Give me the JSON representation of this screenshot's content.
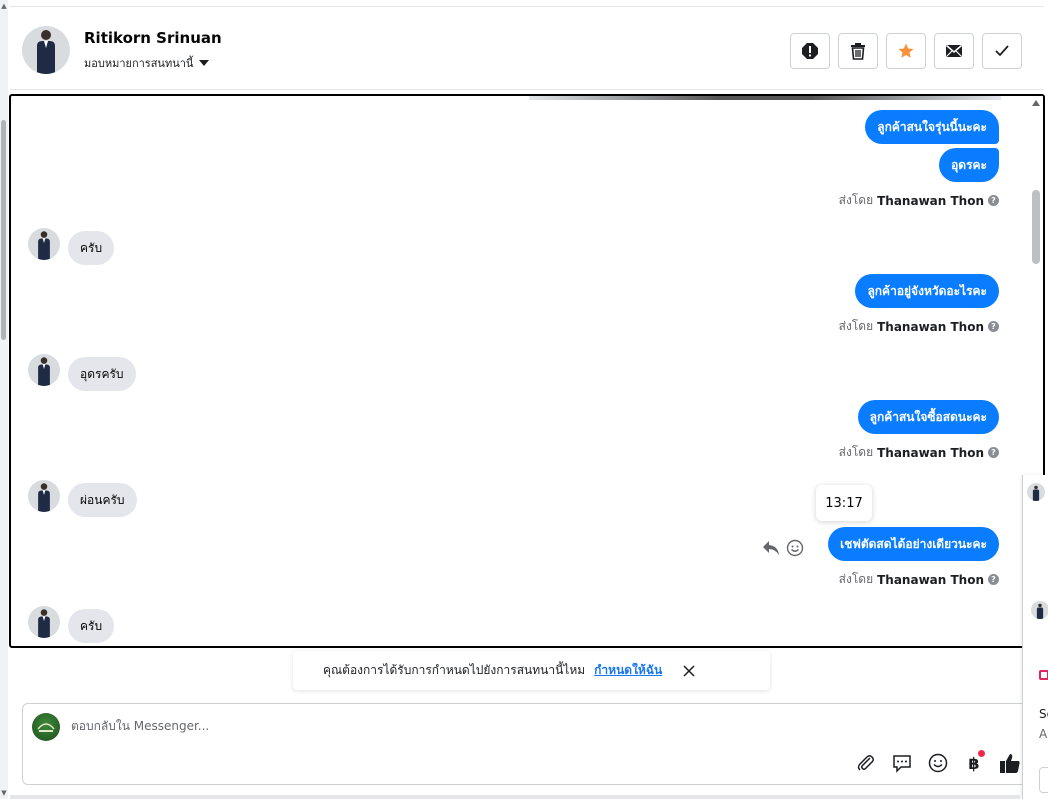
{
  "header": {
    "contact_name": "Ritikorn Srinuan",
    "assign_label": "มอบหมายการสนทนานี้",
    "actions": [
      {
        "name": "report-button",
        "icon": "alert-icon"
      },
      {
        "name": "delete-button",
        "icon": "trash-icon"
      },
      {
        "name": "star-button",
        "icon": "star-icon",
        "color": "#f7923a"
      },
      {
        "name": "mark-unread-button",
        "icon": "envelope-icon"
      },
      {
        "name": "mark-done-button",
        "icon": "check-icon"
      }
    ]
  },
  "messages": {
    "out1": "ลูกค้าสนใจรุ่นนี้นะคะ",
    "out2": "อุดรคะ",
    "in1": "ครับ",
    "out3": "ลูกค้าอยู่จังหวัดอะไรคะ",
    "in2": "อุดรครับ",
    "out4": "ลูกค้าสนใจซื้อสดนะคะ",
    "in3": "ผ่อนครับ",
    "out5": "เชฟตัดสดได้อย่างเดียวนะคะ",
    "in4": "ครับ",
    "sent_by_prefix": "ส่งโดย",
    "sent_by_name": "Thanawan Thon",
    "tooltip_time": "13:17",
    "help_mark": "?"
  },
  "banner": {
    "text": "คุณต้องการได้รับการกำหนดไปยังการสนทนานี้ไหม",
    "link": "กำหนดให้ฉัน"
  },
  "composer": {
    "placeholder": "ตอบกลับใน Messenger...",
    "currency_symbol": "฿"
  },
  "right_panel": {
    "text1": "Se",
    "text2": "A"
  },
  "colors": {
    "outgoing_bubble": "#0a7cff",
    "incoming_bubble": "#e4e6eb",
    "link": "#1877f2",
    "notification_dot": "#f02849"
  }
}
